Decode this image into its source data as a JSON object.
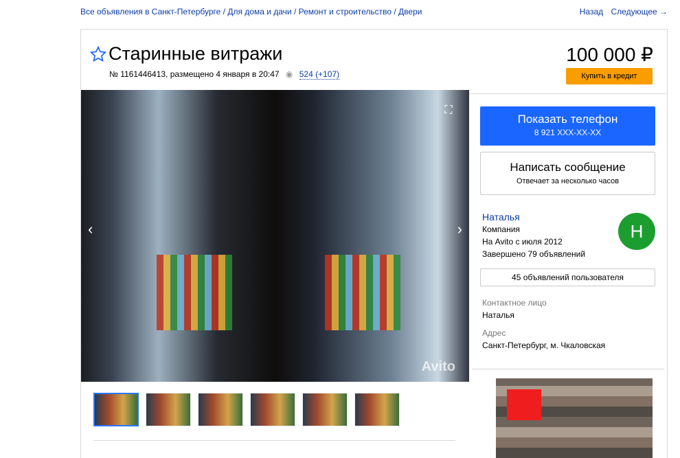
{
  "breadcrumb": {
    "text": "Все объявления в Санкт-Петербурге / Для дома и дачи / Ремонт и строительство / Двери"
  },
  "pager": {
    "back": "Назад",
    "next": "Следующее →"
  },
  "listing": {
    "title": "Старинные витражи",
    "meta": "№ 1161446413, размещено 4 января в 20:47",
    "views": "524 (+107)",
    "price": "100 000 ₽",
    "credit_button": "Купить в кредит"
  },
  "gallery": {
    "watermark": "Avito",
    "thumbnail_count": 6
  },
  "actions": {
    "phone_label": "Показать телефон",
    "phone_number": "8 921 XXX-XX-XX",
    "message_label": "Написать сообщение",
    "message_sub": "Отвечает за несколько часов"
  },
  "seller": {
    "name": "Наталья",
    "type": "Компания",
    "since": "На Avito с июля 2012",
    "completed": "Завершено 79 объявлений",
    "avatar_letter": "Н",
    "ads_button": "45 объявлений пользователя"
  },
  "contact": {
    "person_label": "Контактное лицо",
    "person_value": "Наталья",
    "address_label": "Адрес",
    "address_value": "Санкт-Петербург, м. Чкаловская"
  },
  "colors": {
    "primary_blue": "#1a66ff",
    "link_blue": "#0a3ca5",
    "credit_orange": "#f99d00",
    "avatar_green": "#1b9e2f"
  }
}
